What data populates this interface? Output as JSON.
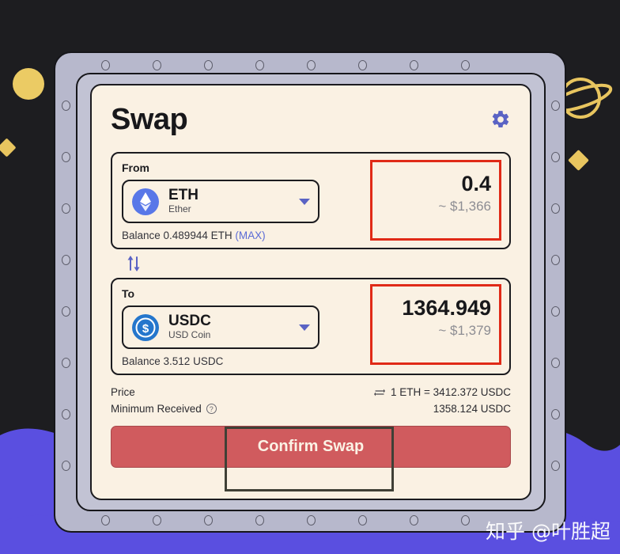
{
  "app": {
    "title": "Swap",
    "settings_icon": "gear-icon",
    "watermark": "知乎 @叶胜超"
  },
  "from": {
    "label": "From",
    "token_symbol": "ETH",
    "token_name": "Ether",
    "token_icon": "ethereum-icon",
    "balance": "Balance 0.489944 ETH",
    "max_label": "(MAX)",
    "amount": "0.4",
    "amount_usd": "~ $1,366",
    "highlight_color": "#E02A17"
  },
  "switch": {
    "icon": "swap-vertical-arrows-icon"
  },
  "to": {
    "label": "To",
    "token_symbol": "USDC",
    "token_name": "USD Coin",
    "token_icon": "usdc-icon",
    "balance": "Balance 3.512 USDC",
    "amount": "1364.949",
    "amount_usd": "~ $1,379",
    "highlight_color": "#E02A17"
  },
  "details": {
    "price_label": "Price",
    "price_value": "1 ETH = 3412.372 USDC",
    "price_swap_icon": "swap-horizontal-arrows-icon",
    "minimum_label": "Minimum Received",
    "minimum_help_icon": "question-mark-icon",
    "minimum_value": "1358.124 USDC"
  },
  "action": {
    "confirm_label": "Confirm Swap",
    "confirm_color": "#D05B5E"
  },
  "theme": {
    "background": "#1d1d20",
    "card": "#FAF1E3",
    "frame": "#B7B8CC",
    "accent_blue": "#5A6BD6",
    "accent_purple": "#5A4FE0",
    "accent_yellow": "#E8C55F"
  }
}
